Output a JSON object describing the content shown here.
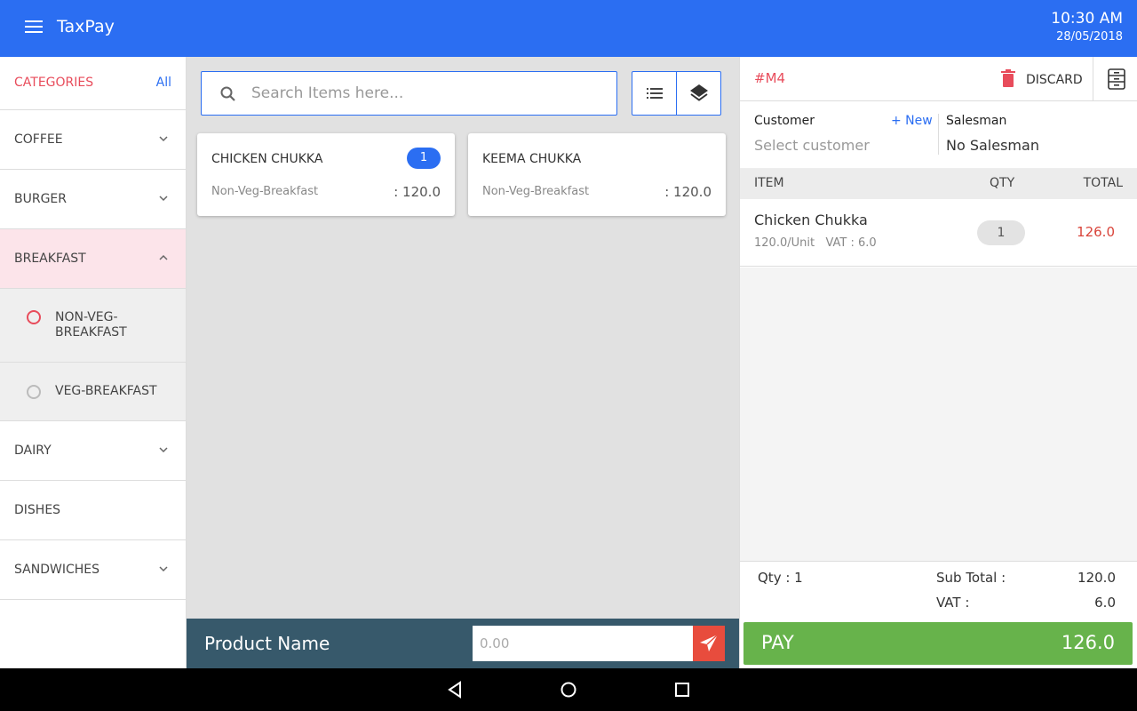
{
  "app": {
    "title": "TaxPay",
    "time": "10:30 AM",
    "date": "28/05/2018"
  },
  "sidebar": {
    "header": "CATEGORIES",
    "all_label": "All",
    "items": [
      {
        "label": "COFFEE"
      },
      {
        "label": "BURGER"
      },
      {
        "label": "BREAKFAST"
      },
      {
        "label": "DAIRY"
      },
      {
        "label": "DISHES"
      },
      {
        "label": "SANDWICHES"
      }
    ],
    "subitems": [
      {
        "label": "NON-VEG-BREAKFAST"
      },
      {
        "label": "VEG-BREAKFAST"
      }
    ]
  },
  "search": {
    "placeholder": "Search Items here..."
  },
  "products": [
    {
      "name": "CHICKEN CHUKKA",
      "badge": "1",
      "category": "Non-Veg-Breakfast",
      "price": ": 120.0"
    },
    {
      "name": "KEEMA CHUKKA",
      "category": "Non-Veg-Breakfast",
      "price": ": 120.0"
    }
  ],
  "product_bar": {
    "label": "Product Name",
    "placeholder": "0.00"
  },
  "order": {
    "id": "#M4",
    "discard_label": "DISCARD",
    "customer_label": "Customer",
    "new_label": "+ New",
    "customer_placeholder": "Select customer",
    "salesman_label": "Salesman",
    "salesman_value": "No Salesman",
    "columns": {
      "item": "ITEM",
      "qty": "QTY",
      "total": "TOTAL"
    },
    "lines": [
      {
        "name": "Chicken Chukka",
        "unit": "120.0/Unit",
        "vat": "VAT : 6.0",
        "qty": "1",
        "total": "126.0"
      }
    ],
    "qty_summary": "Qty : 1",
    "subtotal_label": "Sub Total :",
    "subtotal_value": "120.0",
    "vat_label": "VAT :",
    "vat_value": "6.0",
    "pay_label": "PAY",
    "pay_amount": "126.0"
  },
  "colors": {
    "primary": "#2b6ef2",
    "accent_red": "#e84c5b",
    "pay_green": "#67b34b",
    "product_bar": "#37596b"
  },
  "icons": [
    "menu-icon",
    "search-icon",
    "list-view-icon",
    "layers-icon",
    "delete-icon",
    "cash-drawer-icon",
    "send-icon",
    "back-icon",
    "home-icon",
    "recents-icon"
  ]
}
